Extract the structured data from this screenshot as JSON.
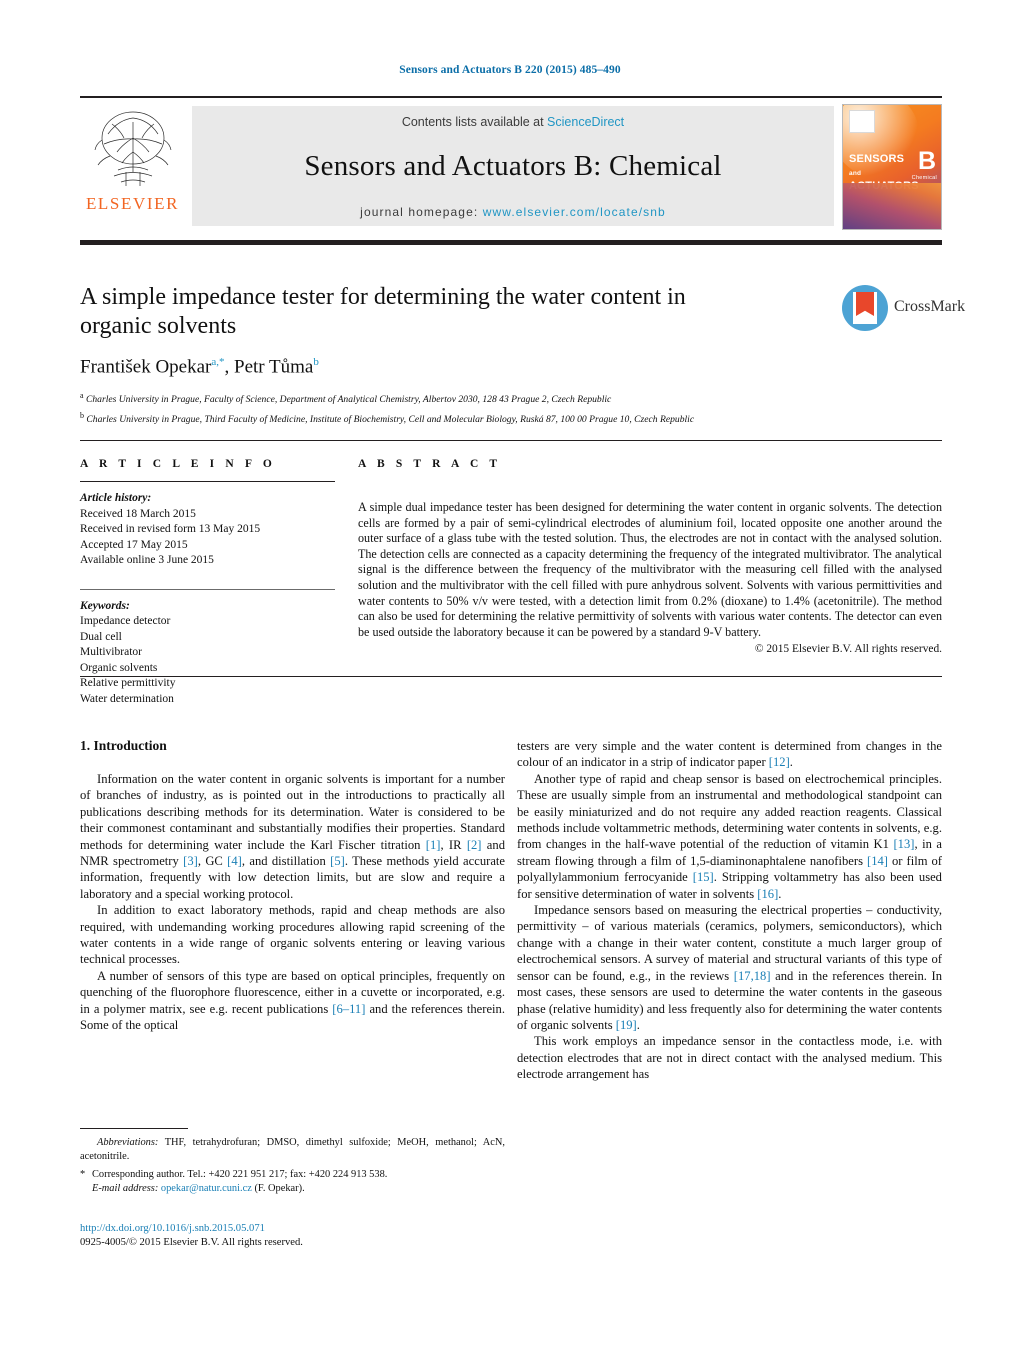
{
  "running_head": "Sensors and Actuators B 220 (2015) 485–490",
  "masthead": {
    "contents_prefix": "Contents lists available at ",
    "sciencedirect": "ScienceDirect",
    "journal_name": "Sensors and Actuators B: Chemical",
    "homepage_label": "journal homepage: ",
    "homepage_url": "www.elsevier.com/locate/snb",
    "publisher_logo_text": "ELSEVIER",
    "cover": {
      "line1": "SENSORS",
      "line1_small": "and",
      "line2": "ACTUATORS",
      "volume_letter": "B",
      "volume_sub": "Chemical"
    },
    "accent_blue": "#2196c4",
    "elsevier_orange": "#f26522"
  },
  "article": {
    "title": "A simple impedance tester for determining the water content in organic solvents",
    "crossmark_label": "CrossMark",
    "authors": [
      {
        "name": "František Opekar",
        "marks": "a,*"
      },
      {
        "name": "Petr Tůma",
        "marks": "b"
      }
    ],
    "authors_line_separator": ", ",
    "affiliations": [
      {
        "mark": "a",
        "text": "Charles University in Prague, Faculty of Science, Department of Analytical Chemistry, Albertov 2030, 128 43 Prague 2, Czech Republic"
      },
      {
        "mark": "b",
        "text": "Charles University in Prague, Third Faculty of Medicine, Institute of Biochemistry, Cell and Molecular Biology, Ruská 87, 100 00 Prague 10, Czech Republic"
      }
    ]
  },
  "info": {
    "heading": "A R T I C L E   I N F O",
    "history_label": "Article history:",
    "history": [
      "Received 18 March 2015",
      "Received in revised form 13 May 2015",
      "Accepted 17 May 2015",
      "Available online 3 June 2015"
    ],
    "keywords_label": "Keywords:",
    "keywords": [
      "Impedance detector",
      "Dual cell",
      "Multivibrator",
      "Organic solvents",
      "Relative permittivity",
      "Water determination"
    ]
  },
  "abstract": {
    "heading": "A B S T R A C T",
    "text": "A simple dual impedance tester has been designed for determining the water content in organic solvents. The detection cells are formed by a pair of semi-cylindrical electrodes of aluminium foil, located opposite one another around the outer surface of a glass tube with the tested solution. Thus, the electrodes are not in contact with the analysed solution. The detection cells are connected as a capacity determining the frequency of the integrated multivibrator. The analytical signal is the difference between the frequency of the multivibrator with the measuring cell filled with the analysed solution and the multivibrator with the cell filled with pure anhydrous solvent. Solvents with various permittivities and water contents to 50% v/v were tested, with a detection limit from 0.2% (dioxane) to 1.4% (acetonitrile). The method can also be used for determining the relative permittivity of solvents with various water contents. The detector can even be used outside the laboratory because it can be powered by a standard 9-V battery.",
    "copyright": "© 2015 Elsevier B.V. All rights reserved."
  },
  "body": {
    "section_heading": "1.  Introduction",
    "left_paragraphs": [
      "Information on the water content in organic solvents is important for a number of branches of industry, as is pointed out in the introductions to practically all publications describing methods for its determination. Water is considered to be their commonest contaminant and substantially modifies their properties. Standard methods for determining water include the Karl Fischer titration [1], IR [2] and NMR spectrometry [3], GC [4], and distillation [5]. These methods yield accurate information, frequently with low detection limits, but are slow and require a laboratory and a special working protocol.",
      "In addition to exact laboratory methods, rapid and cheap methods are also required, with undemanding working procedures allowing rapid screening of the water contents in a wide range of organic solvents entering or leaving various technical processes.",
      "A number of sensors of this type are based on optical principles, frequently on quenching of the fluorophore fluorescence, either in a cuvette or incorporated, e.g. in a polymer matrix, see e.g. recent publications [6–11] and the references therein. Some of the optical"
    ],
    "right_paragraphs": [
      "testers are very simple and the water content is determined from changes in the colour of an indicator in a strip of indicator paper [12].",
      "Another type of rapid and cheap sensor is based on electrochemical principles. These are usually simple from an instrumental and methodological standpoint can be easily miniaturized and do not require any added reaction reagents. Classical methods include voltammetric methods, determining water contents in solvents, e.g. from changes in the half-wave potential of the reduction of vitamin K1 [13], in a stream flowing through a film of 1,5-diaminonaphtalene nanofibers [14] or film of polyallylammonium ferrocyanide [15]. Stripping voltammetry has also been used for sensitive determination of water in solvents [16].",
      "Impedance sensors based on measuring the electrical properties – conductivity, permittivity – of various materials (ceramics, polymers, semiconductors), which change with a change in their water content, constitute a much larger group of electrochemical sensors. A survey of material and structural variants of this type of sensor can be found, e.g., in the reviews [17,18] and in the references therein. In most cases, these sensors are used to determine the water contents in the gaseous phase (relative humidity) and less frequently also for determining the water contents of organic solvents [19].",
      "This work employs an impedance sensor in the contactless mode, i.e. with detection electrodes that are not in direct contact with the analysed medium. This electrode arrangement has"
    ]
  },
  "footnotes": {
    "abbrev_label": "Abbreviations:",
    "abbrev_text": "  THF, tetrahydrofuran; DMSO, dimethyl sulfoxide; MeOH, methanol; AcN, acetonitrile.",
    "corresponding_star": "*",
    "corresponding_text": "Corresponding author. Tel.: +420 221 951 217; fax: +420 224 913 538.",
    "email_label": "E-mail address:",
    "email": "opekar@natur.cuni.cz",
    "email_suffix": "(F. Opekar)."
  },
  "footer": {
    "doi": "http://dx.doi.org/10.1016/j.snb.2015.05.071",
    "issn_line": "0925-4005/© 2015 Elsevier B.V. All rights reserved."
  }
}
